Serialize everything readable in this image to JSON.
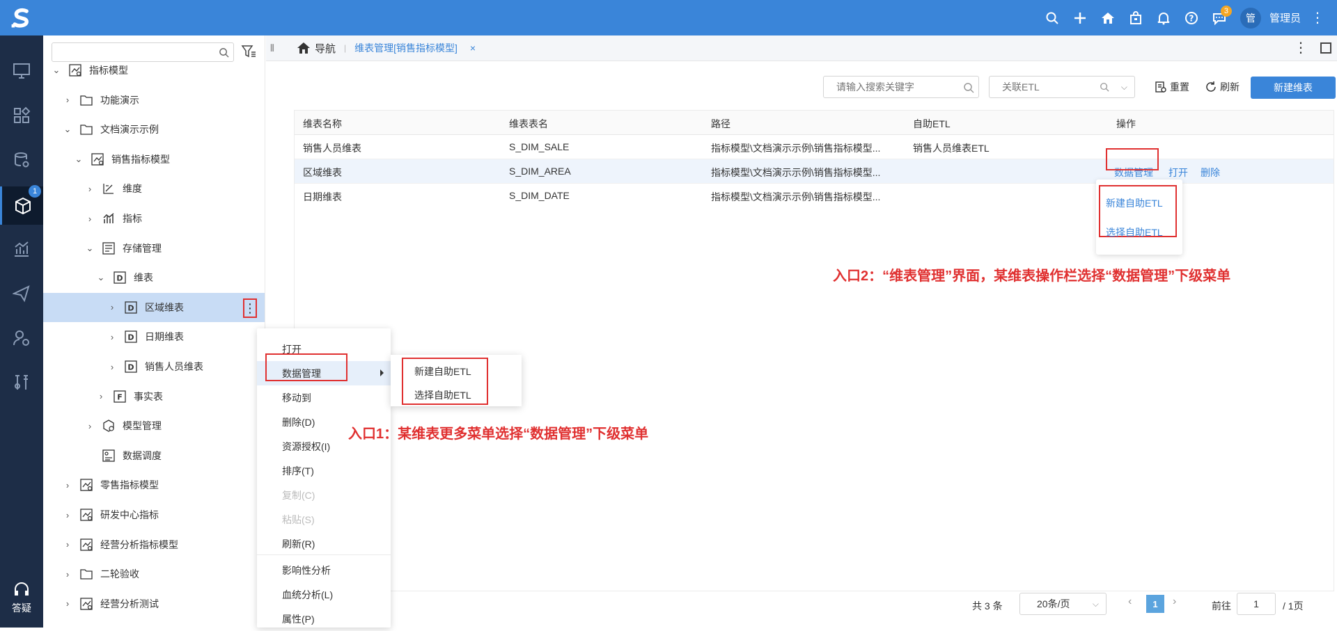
{
  "header": {
    "user_initial": "管",
    "username": "管理员",
    "message_badge": "3",
    "icons": [
      "search-icon",
      "plus-icon",
      "home-icon",
      "bag-icon",
      "bell-icon",
      "help-icon",
      "message-icon",
      "more-icon"
    ]
  },
  "rail": {
    "active_badge": "1",
    "help_label": "答疑"
  },
  "tree": {
    "search_placeholder": "",
    "nodes": [
      {
        "label": "指标模型",
        "level": 0,
        "expanded": true,
        "icon": "model-icon"
      },
      {
        "label": "功能演示",
        "level": 1,
        "expanded": false,
        "icon": "folder-icon"
      },
      {
        "label": "文档演示示例",
        "level": 1,
        "expanded": true,
        "icon": "folder-icon"
      },
      {
        "label": "销售指标模型",
        "level": 2,
        "expanded": true,
        "icon": "model-icon"
      },
      {
        "label": "维度",
        "level": 3,
        "expanded": false,
        "icon": "dimension-icon"
      },
      {
        "label": "指标",
        "level": 3,
        "expanded": false,
        "icon": "metric-icon"
      },
      {
        "label": "存储管理",
        "level": 3,
        "expanded": true,
        "icon": "storage-icon"
      },
      {
        "label": "维表",
        "level": 4,
        "expanded": true,
        "icon": "dim-table-icon"
      },
      {
        "label": "区域维表",
        "level": 5,
        "expanded": false,
        "icon": "dim-table-icon",
        "selected": true
      },
      {
        "label": "日期维表",
        "level": 5,
        "expanded": false,
        "icon": "dim-table-icon"
      },
      {
        "label": "销售人员维表",
        "level": 5,
        "expanded": false,
        "icon": "dim-table-icon"
      },
      {
        "label": "事实表",
        "level": 4,
        "expanded": false,
        "icon": "fact-table-icon"
      },
      {
        "label": "模型管理",
        "level": 3,
        "expanded": false,
        "icon": "model-manage-icon"
      },
      {
        "label": "数据调度",
        "level": 3,
        "expanded": null,
        "icon": "schedule-icon"
      },
      {
        "label": "零售指标模型",
        "level": 1,
        "expanded": false,
        "icon": "model-icon"
      },
      {
        "label": "研发中心指标",
        "level": 1,
        "expanded": false,
        "icon": "model-icon"
      },
      {
        "label": "经营分析指标模型",
        "level": 1,
        "expanded": false,
        "icon": "model-icon"
      },
      {
        "label": "二轮验收",
        "level": 1,
        "expanded": false,
        "icon": "folder-icon"
      },
      {
        "label": "经营分析测试",
        "level": 1,
        "expanded": false,
        "icon": "model-icon"
      }
    ]
  },
  "tabbar": {
    "home_label": "导航",
    "tab_label": "维表管理[销售指标模型]",
    "close_glyph": "×"
  },
  "toolbar": {
    "search_placeholder": "请输入搜索关键字",
    "etl_placeholder": "关联ETL",
    "reset_label": "重置",
    "refresh_label": "刷新",
    "new_label": "新建维表"
  },
  "table": {
    "columns": [
      "维表名称",
      "维表表名",
      "路径",
      "自助ETL",
      "操作"
    ],
    "rows": [
      {
        "name": "销售人员维表",
        "table": "S_DIM_SALE",
        "path": "指标模型\\文档演示示例\\销售指标模型...",
        "etl": "销售人员维表ETL"
      },
      {
        "name": "区域维表",
        "table": "S_DIM_AREA",
        "path": "指标模型\\文档演示示例\\销售指标模型...",
        "etl": ""
      },
      {
        "name": "日期维表",
        "table": "S_DIM_DATE",
        "path": "指标模型\\文档演示示例\\销售指标模型...",
        "etl": ""
      }
    ],
    "ops": {
      "data_manage": "数据管理",
      "open": "打开",
      "delete": "删除"
    }
  },
  "op_dropdown": {
    "new_etl": "新建自助ETL",
    "select_etl": "选择自助ETL"
  },
  "context_menu": {
    "items": [
      {
        "label": "打开",
        "disabled": false
      },
      {
        "label": "数据管理",
        "disabled": false,
        "submenu": true
      },
      {
        "label": "移动到",
        "disabled": false
      },
      {
        "label": "删除(D)",
        "disabled": false
      },
      {
        "label": "资源授权(I)",
        "disabled": false
      },
      {
        "label": "排序(T)",
        "disabled": false
      },
      {
        "label": "复制(C)",
        "disabled": true
      },
      {
        "label": "粘贴(S)",
        "disabled": true
      },
      {
        "label": "刷新(R)",
        "disabled": false
      },
      {
        "label": "影响性分析",
        "disabled": false
      },
      {
        "label": "血统分析(L)",
        "disabled": false
      },
      {
        "label": "属性(P)",
        "disabled": false
      }
    ]
  },
  "submenu": {
    "new_etl": "新建自助ETL",
    "select_etl": "选择自助ETL"
  },
  "annotations": {
    "entry1": "入口1：某维表更多菜单选择“数据管理”下级菜单",
    "entry2": "入口2：“维表管理”界面，某维表操作栏选择“数据管理”下级菜单"
  },
  "pager": {
    "count": "共 3 条",
    "page_size": "20条/页",
    "current": "1",
    "goto_label": "前往",
    "goto_value": "1",
    "total_pages": "/ 1页"
  },
  "colors": {
    "primary": "#3a85d9",
    "rail": "#1d2d47",
    "highlight": "#e03030"
  }
}
